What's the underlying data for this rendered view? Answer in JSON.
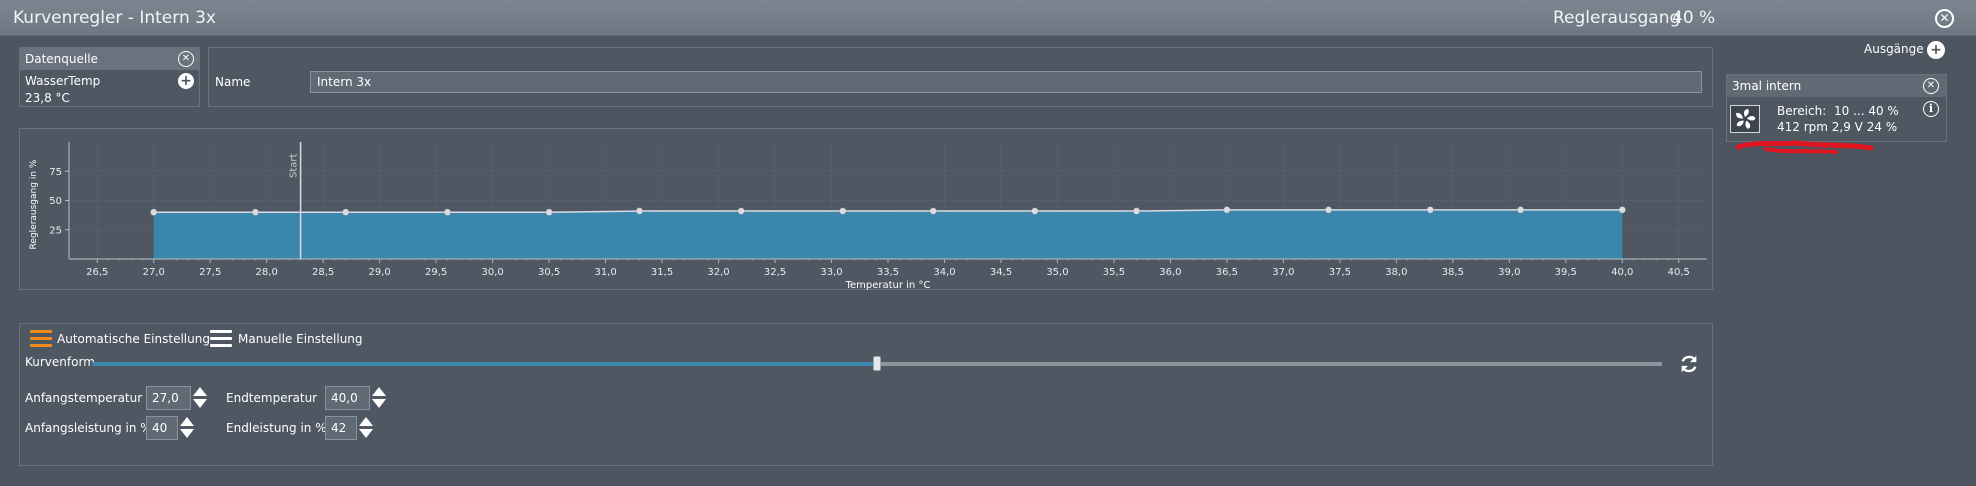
{
  "titlebar": {
    "title": "Kurvenregler  -  Intern 3x",
    "output_label": "Reglerausgang",
    "output_value": "40 %"
  },
  "datasource": {
    "header": "Datenquelle",
    "sensor": "WasserTemp",
    "value": "23,8 °C"
  },
  "name_field": {
    "label": "Name",
    "value": "Intern 3x"
  },
  "outputs": {
    "header": "Ausgänge",
    "item": {
      "title": "3mal intern",
      "range_label": "Bereich:",
      "range_value": "10 ... 40  %",
      "status": "412 rpm  2,9 V  24 %"
    }
  },
  "chart_data": {
    "type": "area",
    "xlabel": "Temperatur in °C",
    "ylabel": "Reglerausgang in %",
    "xlim": [
      26.25,
      40.75
    ],
    "ylim": [
      0,
      100
    ],
    "x_ticks": [
      "26,5",
      "27,0",
      "27,5",
      "28,0",
      "28,5",
      "29,0",
      "29,5",
      "30,0",
      "30,5",
      "31,0",
      "31,5",
      "32,0",
      "32,5",
      "33,0",
      "33,5",
      "34,0",
      "34,5",
      "35,0",
      "35,5",
      "36,0",
      "36,5",
      "37,0",
      "37,5",
      "38,0",
      "38,5",
      "39,0",
      "39,5",
      "40,0",
      "40,5"
    ],
    "y_ticks": [
      "25",
      "50",
      "75"
    ],
    "marker_label": "Start",
    "marker_x": 28.3,
    "grid": true,
    "colors": {
      "fill": "#3a86ad",
      "line": "#d9dde2",
      "point": "#d9dde2",
      "marker": "#d9dde2"
    },
    "points": [
      {
        "x": 27.0,
        "y": 40
      },
      {
        "x": 27.9,
        "y": 40
      },
      {
        "x": 28.7,
        "y": 40
      },
      {
        "x": 29.6,
        "y": 40
      },
      {
        "x": 30.5,
        "y": 40
      },
      {
        "x": 31.3,
        "y": 41
      },
      {
        "x": 32.2,
        "y": 41
      },
      {
        "x": 33.1,
        "y": 41
      },
      {
        "x": 33.9,
        "y": 41
      },
      {
        "x": 34.8,
        "y": 41
      },
      {
        "x": 35.7,
        "y": 41
      },
      {
        "x": 36.5,
        "y": 42
      },
      {
        "x": 37.4,
        "y": 42
      },
      {
        "x": 38.3,
        "y": 42
      },
      {
        "x": 39.1,
        "y": 42
      },
      {
        "x": 40.0,
        "y": 42
      }
    ]
  },
  "modes": {
    "auto_label": "Automatische Einstellung",
    "manual_label": "Manuelle Einstellung",
    "auto_icon": "list-icon",
    "manual_icon": "list-icon",
    "auto_color": "#f08a1c",
    "manual_color": "#ffffff"
  },
  "curve": {
    "label": "Kurvenform",
    "slider_value": 0.5,
    "reset_icon": "refresh-icon"
  },
  "fields": {
    "start_temp_label": "Anfangstemperatur",
    "start_temp_value": "27,0",
    "end_temp_label": "Endtemperatur",
    "end_temp_value": "40,0",
    "start_power_label": "Anfangsleistung in %",
    "start_power_value": "40",
    "end_power_label": "Endleistung in %",
    "end_power_value": "42"
  }
}
